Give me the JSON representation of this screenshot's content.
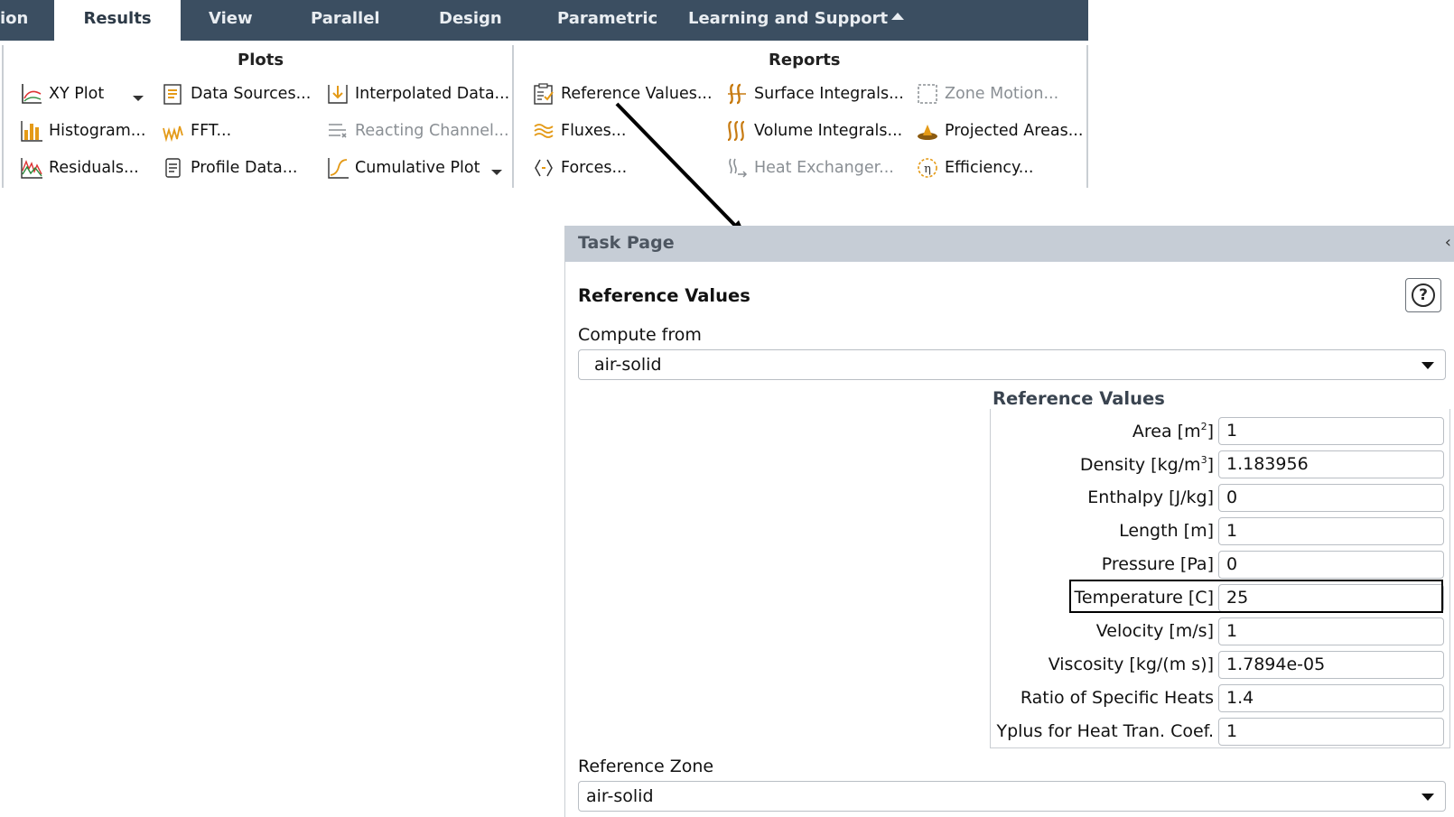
{
  "tabs": [
    {
      "label": "ion",
      "active": false
    },
    {
      "label": "Results",
      "active": true
    },
    {
      "label": "View",
      "active": false
    },
    {
      "label": "Parallel",
      "active": false
    },
    {
      "label": "Design",
      "active": false
    },
    {
      "label": "Parametric",
      "active": false
    },
    {
      "label": "Learning and Support",
      "active": false
    }
  ],
  "ribbon": {
    "plots": {
      "title": "Plots",
      "items": [
        {
          "label": "XY Plot",
          "icon": "xy-plot-icon"
        },
        {
          "label": "Histogram...",
          "icon": "histogram-icon"
        },
        {
          "label": "Residuals...",
          "icon": "residuals-icon"
        },
        {
          "label": "Data Sources...",
          "icon": "data-sources-icon"
        },
        {
          "label": "FFT...",
          "icon": "fft-icon"
        },
        {
          "label": "Profile Data...",
          "icon": "profile-data-icon"
        },
        {
          "label": "Interpolated Data...",
          "icon": "interpolated-data-icon"
        },
        {
          "label": "Reacting Channel...",
          "icon": "reacting-channel-icon",
          "disabled": true
        },
        {
          "label": "Cumulative Plot",
          "icon": "cumulative-plot-icon"
        }
      ]
    },
    "reports": {
      "title": "Reports",
      "items": [
        {
          "label": "Reference Values...",
          "icon": "reference-values-icon"
        },
        {
          "label": "Fluxes...",
          "icon": "fluxes-icon"
        },
        {
          "label": "Forces...",
          "icon": "forces-icon"
        },
        {
          "label": "Surface Integrals...",
          "icon": "surface-integrals-icon"
        },
        {
          "label": "Volume Integrals...",
          "icon": "volume-integrals-icon"
        },
        {
          "label": "Heat Exchanger...",
          "icon": "heat-exchanger-icon",
          "disabled": true
        },
        {
          "label": "Zone Motion...",
          "icon": "zone-motion-icon",
          "disabled": true
        },
        {
          "label": "Projected Areas...",
          "icon": "projected-areas-icon"
        },
        {
          "label": "Efficiency...",
          "icon": "efficiency-icon"
        }
      ]
    }
  },
  "task_page": {
    "header": "Task Page",
    "title": "Reference Values",
    "compute_from_label": "Compute from",
    "compute_from_value": "air-solid",
    "group_title": "Reference Values",
    "rows": [
      {
        "label": "Area [m",
        "sup": "2",
        "tail": "]",
        "value": "1"
      },
      {
        "label": "Density [kg/m",
        "sup": "3",
        "tail": "]",
        "value": "1.183956"
      },
      {
        "label": "Enthalpy [J/kg]",
        "value": "0"
      },
      {
        "label": "Length [m]",
        "value": "1"
      },
      {
        "label": "Pressure [Pa]",
        "value": "0"
      },
      {
        "label": "Temperature [C]",
        "value": "25"
      },
      {
        "label": "Velocity [m/s]",
        "value": "1"
      },
      {
        "label": "Viscosity [kg/(m s)]",
        "value": "1.7894e-05"
      },
      {
        "label": "Ratio of Specific Heats",
        "value": "1.4"
      },
      {
        "label": "Yplus for Heat Tran. Coef.",
        "value": "1"
      }
    ],
    "reference_zone_label": "Reference Zone",
    "reference_zone_value": "air-solid"
  },
  "colors": {
    "tabbar_bg": "#3b4e61",
    "taskpage_header_bg": "#c6cdd6",
    "highlight_border": "#000000"
  }
}
